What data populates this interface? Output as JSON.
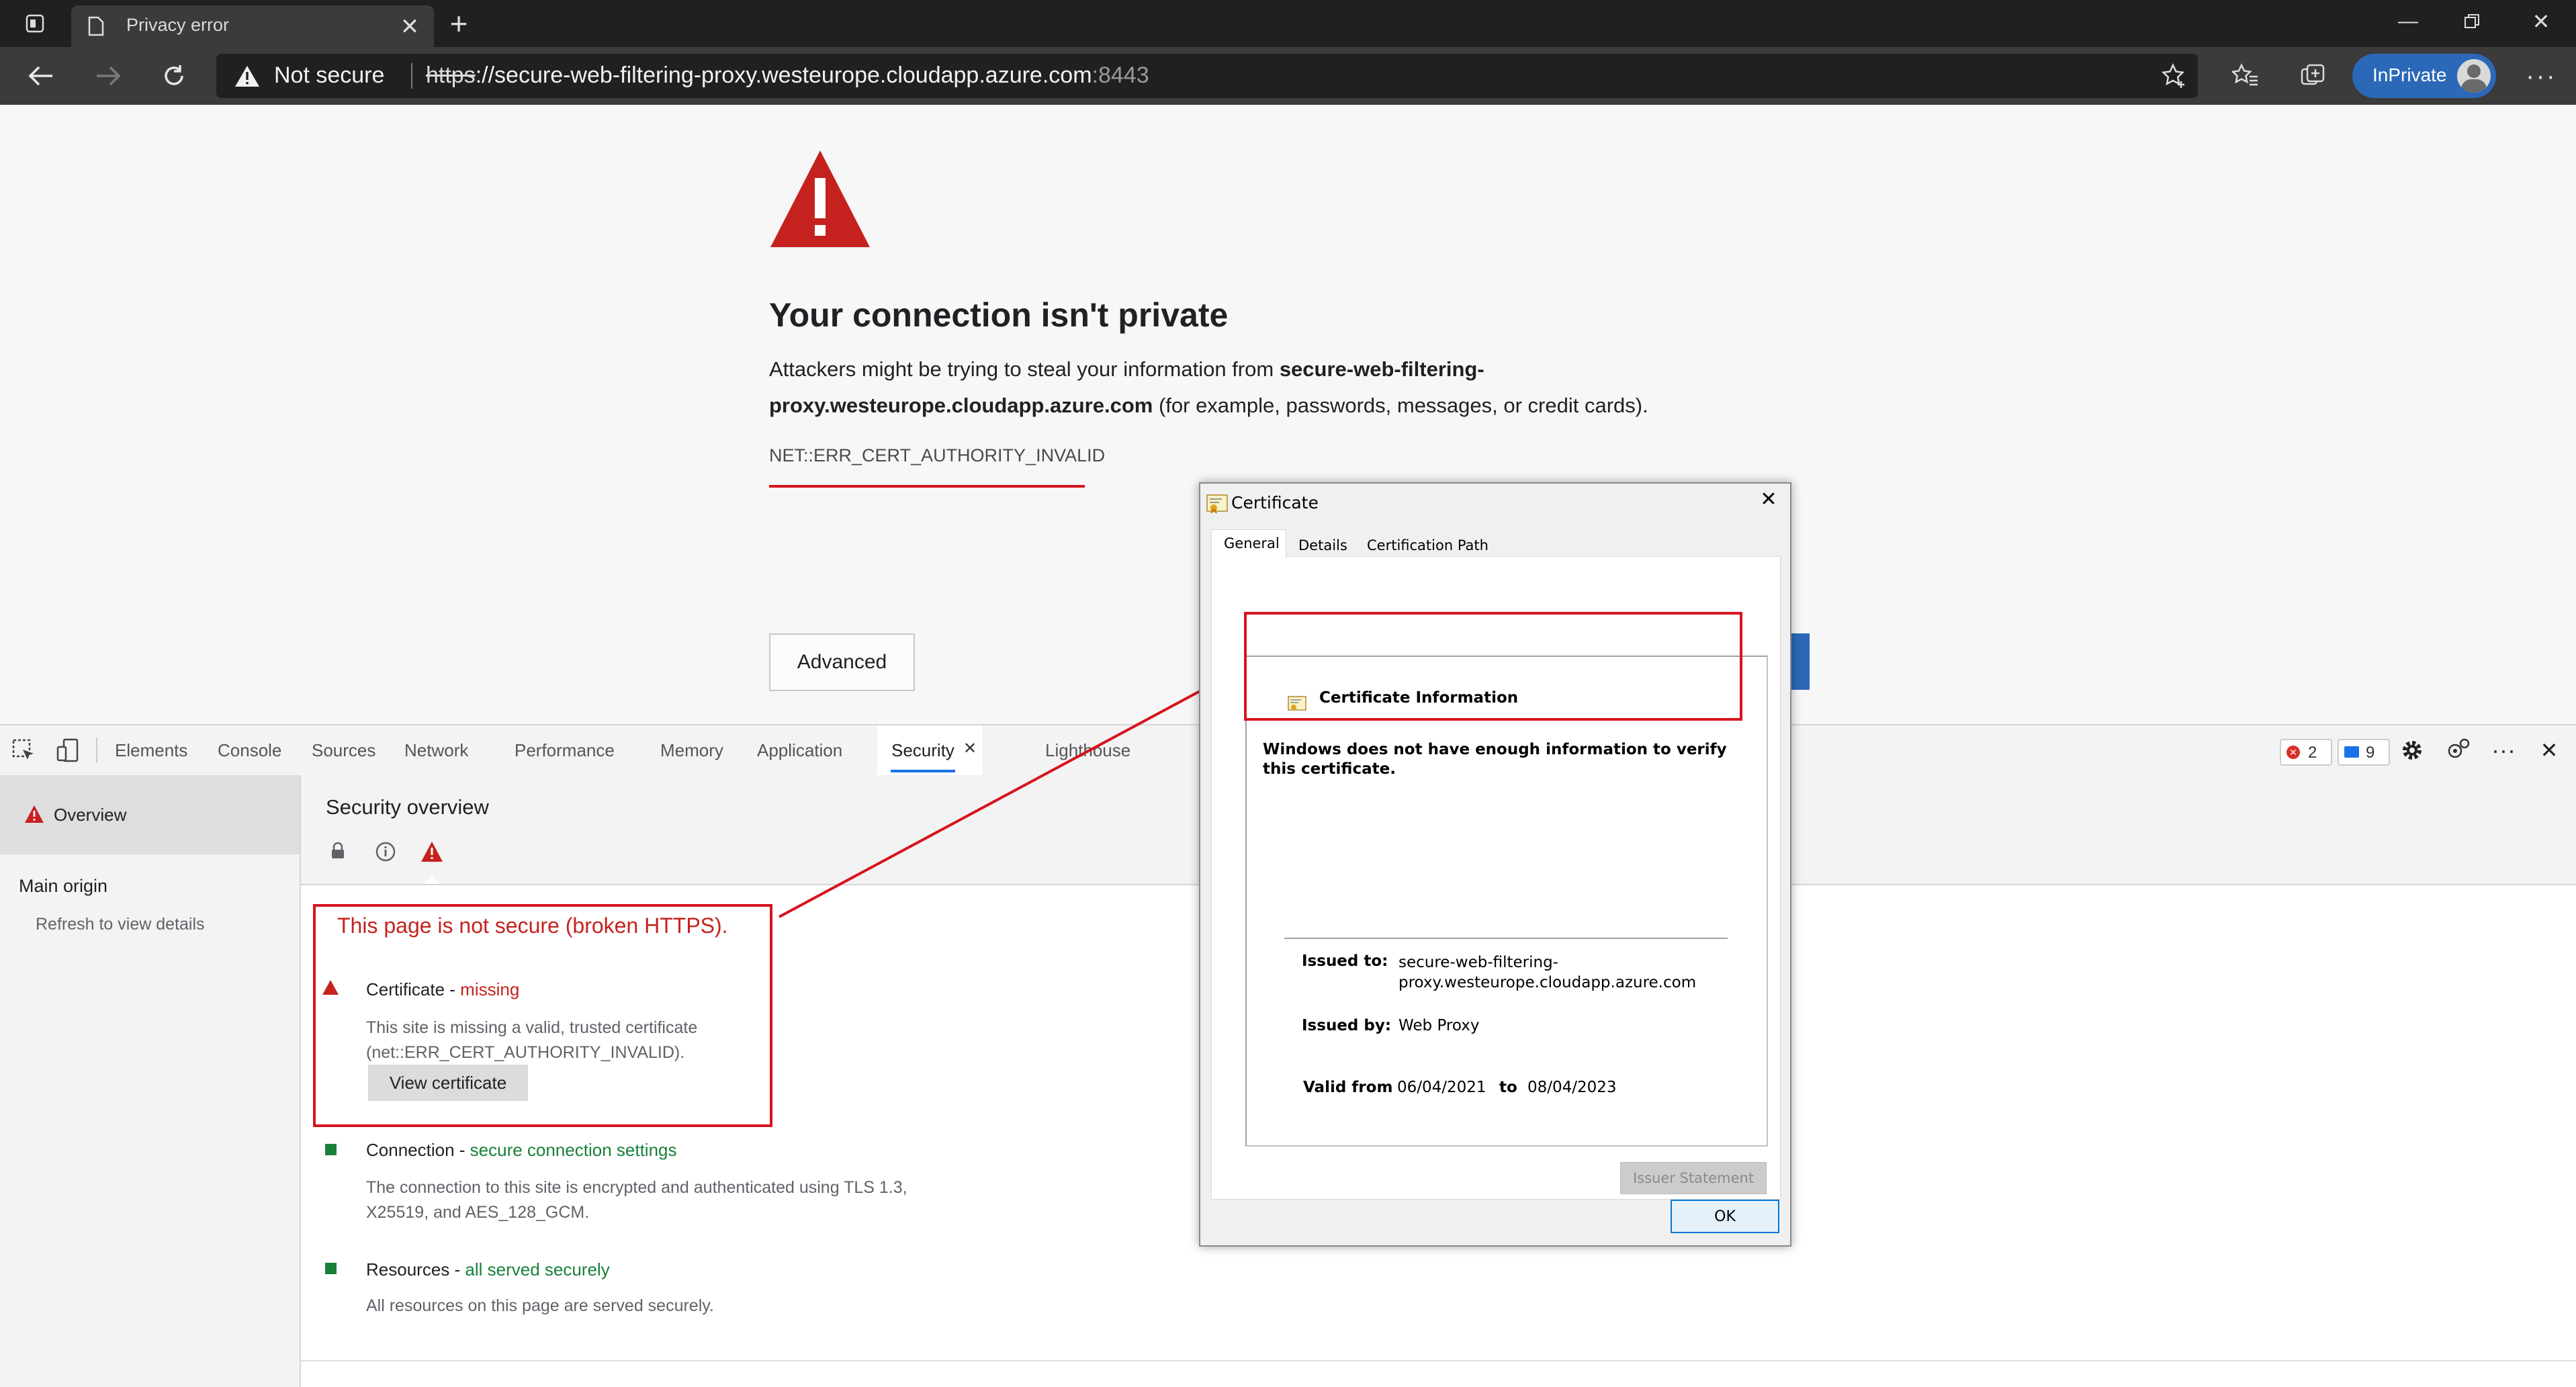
{
  "browser": {
    "tab_title": "Privacy error",
    "security_label": "Not secure",
    "url_scheme": "https",
    "url_host": "://secure-web-filtering-proxy.westeurope.cloudapp.azure.com",
    "url_port": ":8443",
    "inprivate_label": "InPrivate"
  },
  "page": {
    "heading": "Your connection isn't private",
    "body_part1": "Attackers might be trying to steal your information from ",
    "body_host_bold1": "secure-web-filtering-",
    "body_host_bold2": "proxy.westeurope.cloudapp.azure.com",
    "body_part2": " (for example, passwords, messages, or credit cards).",
    "error_code": "NET::ERR_CERT_AUTHORITY_INVALID",
    "advanced_button": "Advanced"
  },
  "devtools": {
    "tabs": [
      "Elements",
      "Console",
      "Sources",
      "Network",
      "Performance",
      "Memory",
      "Application",
      "Security",
      "Lighthouse"
    ],
    "active_tab": "Security",
    "error_count": "2",
    "message_count": "9",
    "sidebar": {
      "overview": "Overview",
      "main_origin": "Main origin",
      "refresh_hint": "Refresh to view details"
    },
    "overview_title": "Security overview",
    "summary": "This page is not secure (broken HTTPS).",
    "certificate": {
      "label": "Certificate",
      "status": "missing",
      "desc_line1": "This site is missing a valid, trusted certificate",
      "desc_line2": "(net::ERR_CERT_AUTHORITY_INVALID).",
      "view_button": "View certificate"
    },
    "connection": {
      "label": "Connection",
      "status": "secure connection settings",
      "desc_line1": "The connection to this site is encrypted and authenticated using TLS 1.3,",
      "desc_line2": "X25519, and AES_128_GCM."
    },
    "resources": {
      "label": "Resources",
      "status": "all served securely",
      "desc": "All resources on this page are served securely."
    },
    "colors": {
      "red": "#c5221f",
      "green": "#188038",
      "annotation": "#d6141d"
    }
  },
  "cert_dialog": {
    "title": "Certificate",
    "tabs": [
      "General",
      "Details",
      "Certification Path"
    ],
    "info_title": "Certificate Information",
    "warning_line1": "Windows does not have enough information to verify",
    "warning_line2": "this certificate.",
    "issued_to_label": "Issued to:",
    "issued_to_line1": "secure-web-filtering-",
    "issued_to_line2": "proxy.westeurope.cloudapp.azure.com",
    "issued_by_label": "Issued by:",
    "issued_by": "Web Proxy",
    "valid_from_label": "Valid from",
    "valid_from": "06/04/2021",
    "valid_to_label": "to",
    "valid_to": "08/04/2023",
    "issuer_statement": "Issuer Statement",
    "ok": "OK"
  }
}
